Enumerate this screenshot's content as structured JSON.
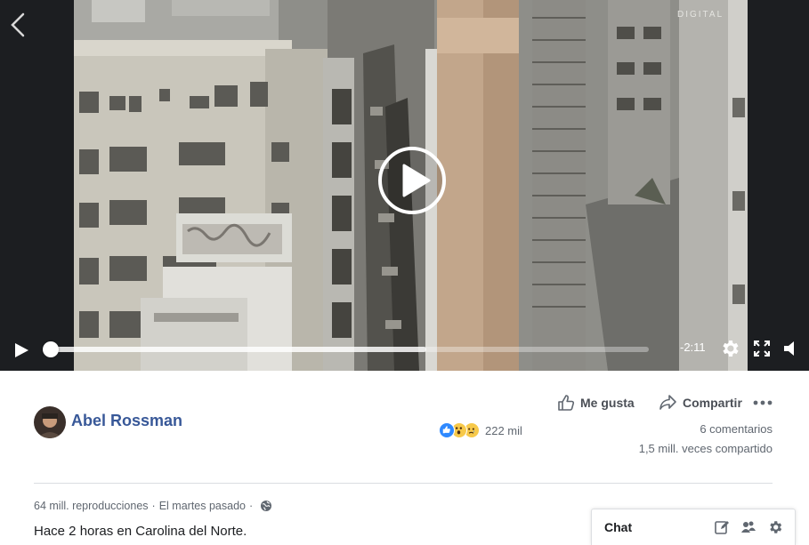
{
  "video": {
    "time_remaining": "-2:11",
    "progress_played": 0.0,
    "progress_buffered": 0.63,
    "icons": [
      "back-chevron-icon",
      "play-icon",
      "gear-icon",
      "fullscreen-icon",
      "volume-icon"
    ],
    "watermark_text": "DIGITAL"
  },
  "post": {
    "author_name": "Abel Rossman",
    "like_label": "Me gusta",
    "share_label": "Compartir",
    "reactions": [
      "like",
      "wow",
      "sad"
    ],
    "reaction_count": "222 mil",
    "comments": "6 comentarios",
    "shares": "1,5 mill. veces compartido",
    "views": "64 mill. reproducciones",
    "separator": "·",
    "date": "El martes pasado",
    "caption": "Hace 2 horas en Carolina del Norte."
  },
  "chat": {
    "title": "Chat",
    "icons": [
      "compose-icon",
      "group-icon",
      "settings-icon"
    ]
  },
  "colors": {
    "link": "#385898",
    "like_blue": "#2e89ff",
    "video_bg": "#1c1e21"
  }
}
